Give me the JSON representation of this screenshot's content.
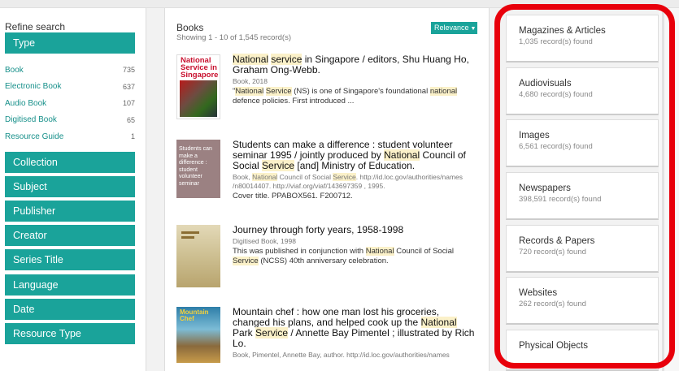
{
  "sidebar": {
    "refine_title": "Refine search",
    "type_facet": {
      "label": "Type",
      "items": [
        {
          "label": "Book",
          "count": "735"
        },
        {
          "label": "Electronic Book",
          "count": "637"
        },
        {
          "label": "Audio Book",
          "count": "107"
        },
        {
          "label": "Digitised Book",
          "count": "65"
        },
        {
          "label": "Resource Guide",
          "count": "1"
        }
      ]
    },
    "facets": [
      "Collection",
      "Subject",
      "Publisher",
      "Creator",
      "Series Title",
      "Language",
      "Date",
      "Resource Type"
    ]
  },
  "results": {
    "title": "Books",
    "count_text": "Showing 1 - 10 of 1,545 record(s)",
    "sort_label": "Relevance",
    "items": [
      {
        "cover_text": "National Service in Singapore",
        "title_parts": [
          "",
          "National",
          " ",
          "service",
          " in Singapore / editors, Shu Huang Ho, Graham Ong-Webb."
        ],
        "meta": "Book, 2018",
        "desc_parts": [
          "\"",
          "National",
          " ",
          "Service",
          " (NS) is one of Singapore's foundational ",
          "national",
          " defence policies. First introduced ..."
        ]
      },
      {
        "cover_text": "Students can make a difference : student volunteer seminar",
        "title_parts": [
          "Students can make a difference : student volunteer seminar 1995 / jointly produced by ",
          "National",
          " Council of Social ",
          "Service",
          " [and] Ministry of Education."
        ],
        "meta_parts": [
          "Book, ",
          "National",
          " Council of Social ",
          "Service",
          ". http://id.loc.gov/authorities/names /n80014407. http://viaf.org/viaf/143697359 , 1995."
        ],
        "desc": "Cover title. PPABOX561. F200712."
      },
      {
        "title": "Journey through forty years, 1958-1998",
        "meta": "Digitised Book, 1998",
        "desc_parts": [
          "This was published in conjunction with ",
          "National",
          " Council of Social ",
          "Service",
          " (NCSS) 40th anniversary celebration."
        ]
      },
      {
        "cover_text": "Mountain Chef",
        "title_parts": [
          "Mountain chef : how one man lost his groceries, changed his plans, and helped cook up the ",
          "National",
          " Park ",
          "Service",
          " / Annette Bay Pimentel ; illustrated by Rich Lo."
        ],
        "meta": "Book, Pimentel, Annette Bay, author. http://id.loc.gov/authorities/names"
      }
    ]
  },
  "categories": [
    {
      "name": "Magazines & Articles",
      "count": "1,035 record(s) found"
    },
    {
      "name": "Audiovisuals",
      "count": "4,680 record(s) found"
    },
    {
      "name": "Images",
      "count": "6,561 record(s) found"
    },
    {
      "name": "Newspapers",
      "count": "398,591 record(s) found"
    },
    {
      "name": "Records & Papers",
      "count": "720 record(s) found"
    },
    {
      "name": "Websites",
      "count": "262 record(s) found"
    },
    {
      "name": "Physical Objects",
      "count": ""
    }
  ],
  "colors": {
    "accent": "#1aa39a",
    "highlight": "#e8000b"
  }
}
